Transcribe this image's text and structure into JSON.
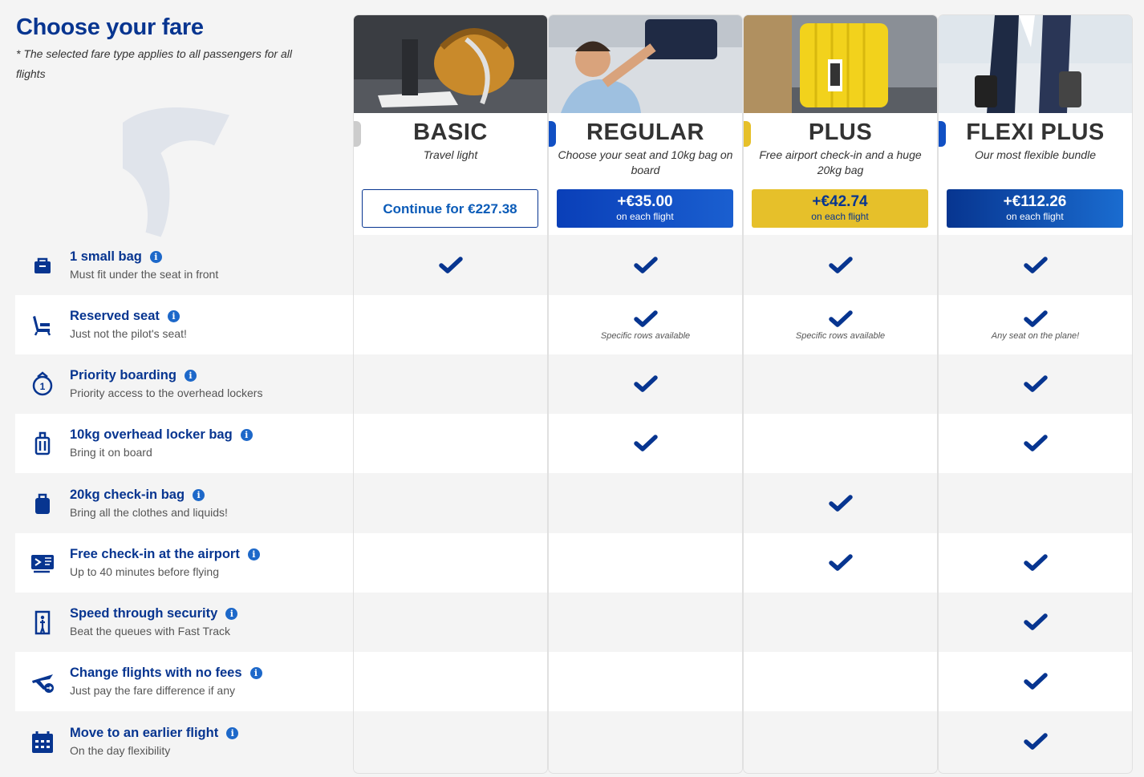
{
  "header": {
    "title": "Choose your fare",
    "subtitle": "* The selected fare type applies to all passengers for all flights"
  },
  "fares": [
    {
      "name": "BASIC",
      "desc": "Travel light",
      "price": "Continue for €227.38",
      "sub": "",
      "accent": "#cccccc",
      "style": "outline"
    },
    {
      "name": "REGULAR",
      "desc": "Choose your seat and 10kg bag on board",
      "price": "+€35.00",
      "sub": "on each flight",
      "accent": "#1150c4",
      "style": "blue"
    },
    {
      "name": "PLUS",
      "desc": "Free airport check-in and a huge 20kg bag",
      "price": "+€42.74",
      "sub": "on each flight",
      "accent": "#e6c02a",
      "style": "yellow"
    },
    {
      "name": "FLEXI PLUS",
      "desc": "Our most flexible bundle",
      "price": "+€112.26",
      "sub": "on each flight",
      "accent": "#1150c4",
      "style": "navy"
    }
  ],
  "features": [
    {
      "title": "1 small bag",
      "sub": "Must fit under the seat in front",
      "icon": "small-bag-icon"
    },
    {
      "title": "Reserved seat",
      "sub": "Just not the pilot's seat!",
      "icon": "seat-icon"
    },
    {
      "title": "Priority boarding",
      "sub": "Priority access to the overhead lockers",
      "icon": "priority-boarding-icon"
    },
    {
      "title": "10kg overhead locker bag",
      "sub": "Bring it on board",
      "icon": "cabin-bag-icon"
    },
    {
      "title": "20kg check-in bag",
      "sub": "Bring all the clothes and liquids!",
      "icon": "checkin-bag-icon"
    },
    {
      "title": "Free check-in at the airport",
      "sub": "Up to 40 minutes before flying",
      "icon": "boarding-pass-icon"
    },
    {
      "title": "Speed through security",
      "sub": "Beat the queues with Fast Track",
      "icon": "security-icon"
    },
    {
      "title": "Change flights with no fees",
      "sub": "Just pay the fare difference if any",
      "icon": "plane-change-icon"
    },
    {
      "title": "Move to an earlier flight",
      "sub": "On the day flexibility",
      "icon": "calendar-icon"
    }
  ],
  "matrix": [
    [
      true,
      true,
      true,
      true
    ],
    [
      false,
      true,
      true,
      true
    ],
    [
      false,
      true,
      false,
      true
    ],
    [
      false,
      true,
      false,
      true
    ],
    [
      false,
      false,
      true,
      false
    ],
    [
      false,
      false,
      true,
      true
    ],
    [
      false,
      false,
      false,
      true
    ],
    [
      false,
      false,
      false,
      true
    ],
    [
      false,
      false,
      false,
      true
    ]
  ],
  "notes": [
    [
      "",
      "",
      "",
      ""
    ],
    [
      "",
      "Specific rows available",
      "Specific rows available",
      "Any seat on the plane!"
    ],
    [
      "",
      "",
      "",
      ""
    ],
    [
      "",
      "",
      "",
      ""
    ],
    [
      "",
      "",
      "",
      ""
    ],
    [
      "",
      "",
      "",
      ""
    ],
    [
      "",
      "",
      "",
      ""
    ],
    [
      "",
      "",
      "",
      ""
    ],
    [
      "",
      "",
      "",
      ""
    ]
  ],
  "colors": {
    "brand": "#073590",
    "check": "#073590",
    "yellow": "#e6c02a"
  }
}
